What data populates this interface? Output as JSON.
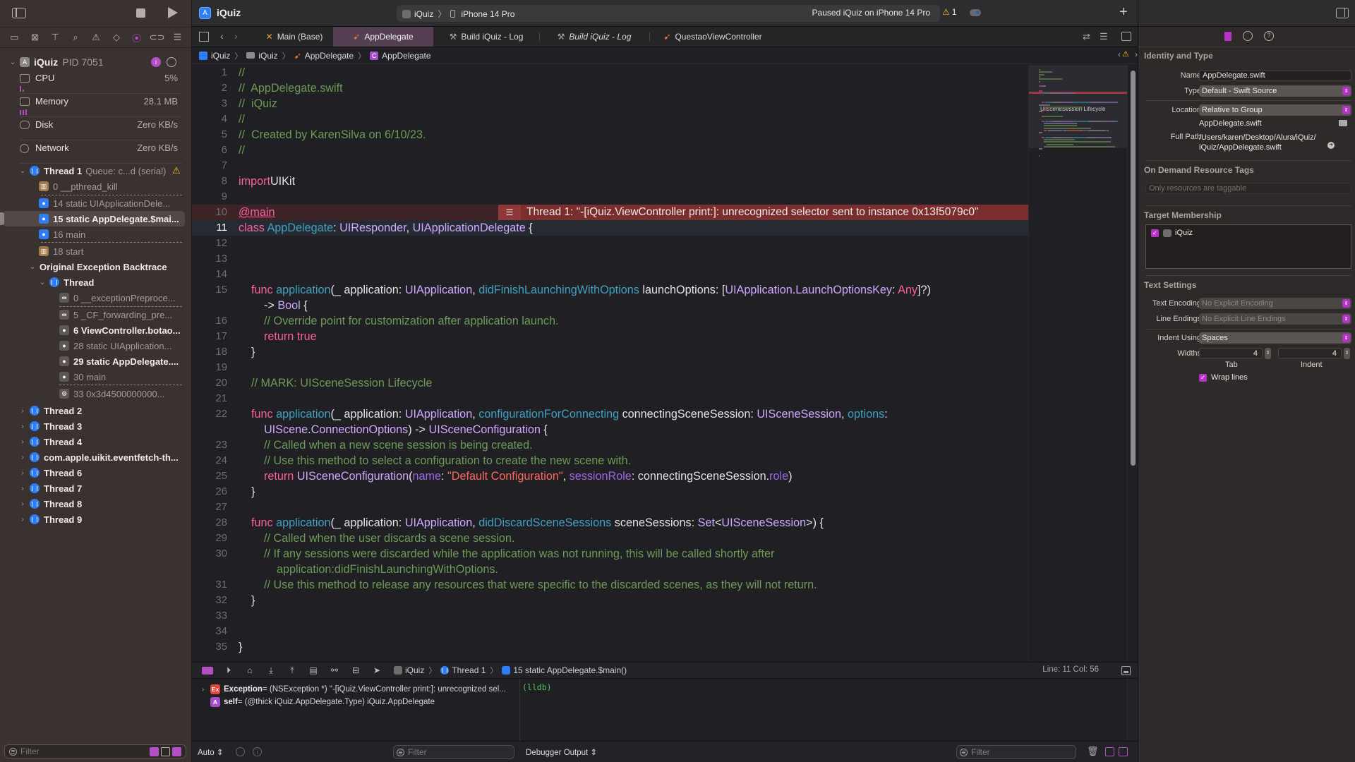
{
  "toolbar": {
    "project_title": "iQuiz",
    "scheme": "iQuiz",
    "destination": "iPhone 14 Pro",
    "activity_status": "Paused iQuiz on iPhone 14 Pro",
    "warning_count": "1",
    "add_label": "+"
  },
  "tabs": [
    {
      "label": "Main (Base)",
      "icon": "interface-builder-icon",
      "active": false
    },
    {
      "label": "AppDelegate",
      "icon": "swift-icon",
      "active": true
    },
    {
      "label": "Build iQuiz - Log",
      "icon": "hammer-icon",
      "active": false
    },
    {
      "label": "Build iQuiz - Log",
      "icon": "hammer-icon",
      "active": false,
      "italic": true
    },
    {
      "label": "QuestaoViewController",
      "icon": "swift-icon",
      "active": false
    }
  ],
  "breadcrumb": [
    "iQuiz",
    "iQuiz",
    "AppDelegate",
    "AppDelegate"
  ],
  "navigator": {
    "process": {
      "name": "iQuiz",
      "pid": "PID 7051"
    },
    "gauges": [
      {
        "label": "CPU",
        "value": "5%"
      },
      {
        "label": "Memory",
        "value": "28.1 MB"
      },
      {
        "label": "Disk",
        "value": "Zero KB/s"
      },
      {
        "label": "Network",
        "value": "Zero KB/s"
      }
    ],
    "thread1": {
      "name": "Thread 1",
      "queue": "Queue: c...d (serial)"
    },
    "thread1_frames": [
      {
        "label": "0 __pthread_kill",
        "kind": "sys",
        "selected": false,
        "bold": false
      },
      {
        "label": "14 static UIApplicationDele...",
        "kind": "user",
        "selected": false,
        "bold": false
      },
      {
        "label": "15 static AppDelegate.$mai...",
        "kind": "user",
        "selected": true,
        "bold": true
      },
      {
        "label": "16 main",
        "kind": "user",
        "selected": false,
        "bold": false
      },
      {
        "label": "18 start",
        "kind": "sys",
        "selected": false,
        "bold": false
      }
    ],
    "backtrace_title": "Original Exception Backtrace",
    "backtrace_thread": "Thread",
    "backtrace_frames": [
      {
        "label": "0 __exceptionPreproce...",
        "kind": "gray",
        "bold": false
      },
      {
        "label": "5 _CF_forwarding_pre...",
        "kind": "gray",
        "bold": false
      },
      {
        "label": "6 ViewController.botao...",
        "kind": "gray",
        "bold": true
      },
      {
        "label": "28 static UIApplication...",
        "kind": "gray",
        "bold": false
      },
      {
        "label": "29 static AppDelegate....",
        "kind": "gray",
        "bold": true
      },
      {
        "label": "30 main",
        "kind": "gray",
        "bold": false
      },
      {
        "label": "33 0x3d4500000000...",
        "kind": "gray",
        "bold": false
      }
    ],
    "other_threads": [
      "Thread 2",
      "Thread 3",
      "Thread 4",
      "com.apple.uikit.eventfetch-th...",
      "Thread 6",
      "Thread 7",
      "Thread 8",
      "Thread 9"
    ],
    "filter_placeholder": "Filter"
  },
  "editor": {
    "error_message": "Thread 1: \"-[iQuiz.ViewController print:]: unrecognized selector sent to instance 0x13f5079c0\"",
    "current_line": 11,
    "error_line": 10
  },
  "minimap": {
    "section_label": "UISceneSession Lifecycle"
  },
  "debugbar": {
    "crumbs": [
      "iQuiz",
      "Thread 1",
      "15 static AppDelegate.$main()"
    ],
    "position": "Line: 11  Col: 56"
  },
  "variables": [
    {
      "badge": "Ex",
      "name": "Exception",
      "value": " = (NSException *) \"-[iQuiz.ViewController print:]: unrecognized sel...",
      "color": "#e0443a"
    },
    {
      "badge": "A",
      "name": "self",
      "value": " = (@thick iQuiz.AppDelegate.Type) iQuiz.AppDelegate",
      "color": "#a550c9"
    }
  ],
  "console": {
    "prompt": "(lldb)",
    "output_selector": "Debugger Output ⇕",
    "filter_placeholder": "Filter"
  },
  "bottombar": {
    "scope": "Auto ⇕",
    "filter_placeholder": "Filter"
  },
  "inspector": {
    "identity_title": "Identity and Type",
    "name_label": "Name",
    "name_value": "AppDelegate.swift",
    "type_label": "Type",
    "type_value": "Default - Swift Source",
    "location_label": "Location",
    "location_value": "Relative to Group",
    "location_file": "AppDelegate.swift",
    "fullpath_label": "Full Path",
    "fullpath_line1": "/Users/karen/Desktop/Alura/iQuiz/",
    "fullpath_line2": "iQuiz/AppDelegate.swift",
    "odr_title": "On Demand Resource Tags",
    "odr_placeholder": "Only resources are taggable",
    "target_title": "Target Membership",
    "target_item": "iQuiz",
    "target_checked": true,
    "text_title": "Text Settings",
    "encoding_label": "Text Encoding",
    "encoding_value": "No Explicit Encoding",
    "endings_label": "Line Endings",
    "endings_value": "No Explicit Line Endings",
    "indent_label": "Indent Using",
    "indent_value": "Spaces",
    "widths_label": "Widths",
    "tab_width": "4",
    "indent_width": "4",
    "tab_caption": "Tab",
    "indent_caption": "Indent",
    "wrap_label": "Wrap lines",
    "wrap_checked": true
  },
  "colors": {
    "accent": "#b533c6",
    "error_banner": "#7a2e2e",
    "keyword": "#fc5fa3",
    "type": "#d0a8ff",
    "function": "#41a1c0",
    "comment": "#6c9a56",
    "string": "#fc6a5d"
  },
  "code_lines": [
    {
      "n": 1,
      "tokens": [
        [
          "cm",
          "//"
        ]
      ]
    },
    {
      "n": 2,
      "tokens": [
        [
          "cm",
          "//  AppDelegate.swift"
        ]
      ]
    },
    {
      "n": 3,
      "tokens": [
        [
          "cm",
          "//  iQuiz"
        ]
      ]
    },
    {
      "n": 4,
      "tokens": [
        [
          "cm",
          "//"
        ]
      ]
    },
    {
      "n": 5,
      "tokens": [
        [
          "cm",
          "//  Created by KarenSilva on 6/10/23."
        ]
      ]
    },
    {
      "n": 6,
      "tokens": [
        [
          "cm",
          "//"
        ]
      ]
    },
    {
      "n": 7,
      "tokens": []
    },
    {
      "n": 8,
      "tokens": [
        [
          "kw",
          "import"
        ],
        [
          "",
          "UIKit"
        ]
      ]
    },
    {
      "n": 9,
      "tokens": []
    },
    {
      "n": 10,
      "tokens": [
        [
          "kwu",
          "@main"
        ]
      ]
    },
    {
      "n": 11,
      "tokens": [
        [
          "kw",
          "class"
        ],
        [
          "",
          " "
        ],
        [
          "fn",
          "AppDelegate"
        ],
        [
          "",
          ": "
        ],
        [
          "ty",
          "UIResponder"
        ],
        [
          "",
          ", "
        ],
        [
          "ty",
          "UIApplicationDelegate"
        ],
        [
          "",
          " {"
        ]
      ]
    },
    {
      "n": 12,
      "tokens": []
    },
    {
      "n": 13,
      "tokens": []
    },
    {
      "n": 14,
      "tokens": []
    },
    {
      "n": 15,
      "tokens": [
        [
          "",
          "    "
        ],
        [
          "kw",
          "func"
        ],
        [
          "",
          " "
        ],
        [
          "fn",
          "application"
        ],
        [
          "",
          "(_ application: "
        ],
        [
          "ty",
          "UIApplication"
        ],
        [
          "",
          ", "
        ],
        [
          "fn",
          "didFinishLaunchingWithOptions"
        ],
        [
          "",
          " launchOptions: ["
        ],
        [
          "ty",
          "UIApplication"
        ],
        [
          "",
          "."
        ],
        [
          "ty",
          "LaunchOptionsKey"
        ],
        [
          "",
          ": "
        ],
        [
          "kw",
          "Any"
        ],
        [
          "",
          "]?)"
        ]
      ]
    },
    {
      "n": null,
      "tokens": [
        [
          "",
          "        -> "
        ],
        [
          "ty",
          "Bool"
        ],
        [
          "",
          " {"
        ]
      ]
    },
    {
      "n": 16,
      "tokens": [
        [
          "",
          "        "
        ],
        [
          "cm",
          "// Override point for customization after application launch."
        ]
      ]
    },
    {
      "n": 17,
      "tokens": [
        [
          "",
          "        "
        ],
        [
          "kw",
          "return"
        ],
        [
          "",
          " "
        ],
        [
          "kw",
          "true"
        ]
      ]
    },
    {
      "n": 18,
      "tokens": [
        [
          "",
          "    }"
        ]
      ]
    },
    {
      "n": 19,
      "tokens": []
    },
    {
      "n": 20,
      "tokens": [
        [
          "",
          "    "
        ],
        [
          "cm",
          "// MARK: UISceneSession Lifecycle"
        ]
      ]
    },
    {
      "n": 21,
      "tokens": []
    },
    {
      "n": 22,
      "tokens": [
        [
          "",
          "    "
        ],
        [
          "kw",
          "func"
        ],
        [
          "",
          " "
        ],
        [
          "fn",
          "application"
        ],
        [
          "",
          "(_ application: "
        ],
        [
          "ty",
          "UIApplication"
        ],
        [
          "",
          ", "
        ],
        [
          "fn",
          "configurationForConnecting"
        ],
        [
          "",
          " connectingSceneSession: "
        ],
        [
          "ty",
          "UISceneSession"
        ],
        [
          "",
          ", "
        ],
        [
          "fn",
          "options"
        ],
        [
          "",
          ":"
        ]
      ]
    },
    {
      "n": null,
      "tokens": [
        [
          "",
          "        "
        ],
        [
          "ty",
          "UIScene"
        ],
        [
          "",
          "."
        ],
        [
          "ty",
          "ConnectionOptions"
        ],
        [
          "",
          ") -> "
        ],
        [
          "ty",
          "UISceneConfiguration"
        ],
        [
          "",
          " {"
        ]
      ]
    },
    {
      "n": 23,
      "tokens": [
        [
          "",
          "        "
        ],
        [
          "cm",
          "// Called when a new scene session is being created."
        ]
      ]
    },
    {
      "n": 24,
      "tokens": [
        [
          "",
          "        "
        ],
        [
          "cm",
          "// Use this method to select a configuration to create the new scene with."
        ]
      ]
    },
    {
      "n": 25,
      "tokens": [
        [
          "",
          "        "
        ],
        [
          "kw",
          "return"
        ],
        [
          "",
          " "
        ],
        [
          "ty",
          "UISceneConfiguration"
        ],
        [
          "",
          "("
        ],
        [
          "pl",
          "name"
        ],
        [
          "",
          ": "
        ],
        [
          "st",
          "\"Default Configuration\""
        ],
        [
          "",
          ", "
        ],
        [
          "pl",
          "sessionRole"
        ],
        [
          "",
          ": connectingSceneSession."
        ],
        [
          "pl",
          "role"
        ],
        [
          "",
          ")"
        ]
      ]
    },
    {
      "n": 26,
      "tokens": [
        [
          "",
          "    }"
        ]
      ]
    },
    {
      "n": 27,
      "tokens": []
    },
    {
      "n": 28,
      "tokens": [
        [
          "",
          "    "
        ],
        [
          "kw",
          "func"
        ],
        [
          "",
          " "
        ],
        [
          "fn",
          "application"
        ],
        [
          "",
          "(_ application: "
        ],
        [
          "ty",
          "UIApplication"
        ],
        [
          "",
          ", "
        ],
        [
          "fn",
          "didDiscardSceneSessions"
        ],
        [
          "",
          " sceneSessions: "
        ],
        [
          "ty",
          "Set"
        ],
        [
          "",
          "<"
        ],
        [
          "ty",
          "UISceneSession"
        ],
        [
          "",
          ">) {"
        ]
      ]
    },
    {
      "n": 29,
      "tokens": [
        [
          "",
          "        "
        ],
        [
          "cm",
          "// Called when the user discards a scene session."
        ]
      ]
    },
    {
      "n": 30,
      "tokens": [
        [
          "",
          "        "
        ],
        [
          "cm",
          "// If any sessions were discarded while the application was not running, this will be called shortly after"
        ]
      ]
    },
    {
      "n": null,
      "tokens": [
        [
          "",
          "            "
        ],
        [
          "cm",
          "application:didFinishLaunchingWithOptions."
        ]
      ]
    },
    {
      "n": 31,
      "tokens": [
        [
          "",
          "        "
        ],
        [
          "cm",
          "// Use this method to release any resources that were specific to the discarded scenes, as they will not return."
        ]
      ]
    },
    {
      "n": 32,
      "tokens": [
        [
          "",
          "    }"
        ]
      ]
    },
    {
      "n": 33,
      "tokens": []
    },
    {
      "n": 34,
      "tokens": []
    },
    {
      "n": 35,
      "tokens": [
        [
          "",
          "}"
        ]
      ]
    }
  ]
}
